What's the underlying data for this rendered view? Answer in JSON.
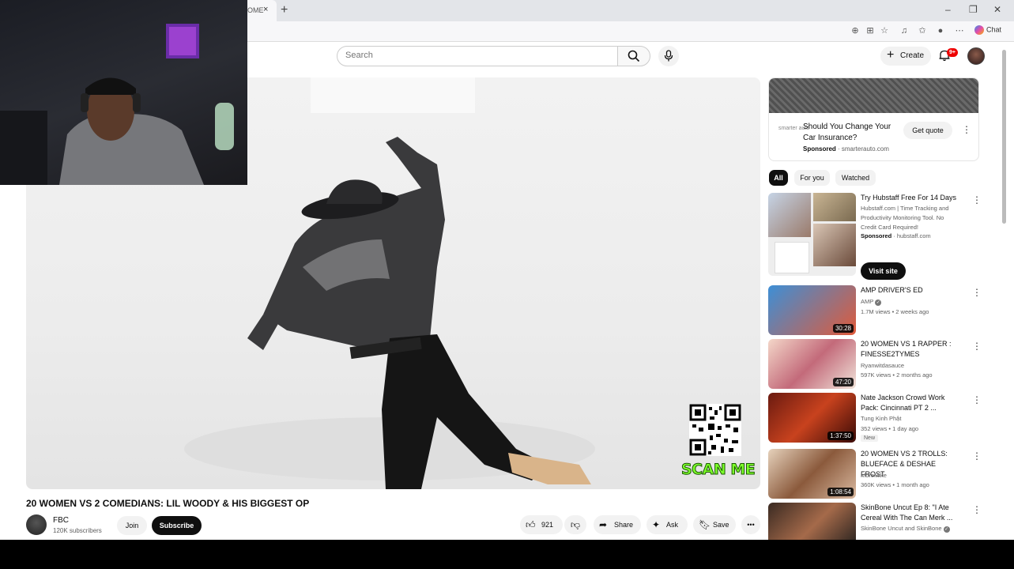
{
  "browser": {
    "tab_title": "OME",
    "tab_close": "×",
    "new_tab": "+",
    "window_buttons": [
      "–",
      "❐",
      "✕"
    ],
    "chat_label": "Chat"
  },
  "header": {
    "search_placeholder": "Search",
    "create_label": "Create",
    "notification_count": "9+"
  },
  "video": {
    "qr_caption": "SCAN ME",
    "title": "20 WOMEN VS 2 COMEDIANS: LIL WOODY & HIS BIGGEST OP",
    "channel_name": "FBC",
    "channel_subs": "120K subscribers",
    "join_label": "Join",
    "subscribe_label": "Subscribe",
    "like_count": "921",
    "share_label": "Share",
    "ask_label": "Ask",
    "save_label": "Save",
    "more_label": "•••"
  },
  "ad": {
    "logo_text": "smarter auto",
    "title": "Should You Change Your Car Insurance?",
    "sponsored": "Sponsored",
    "domain": "smarterauto.com",
    "cta": "Get quote"
  },
  "chips": [
    "All",
    "For you",
    "Watched"
  ],
  "recommendations": [
    {
      "title": "Try Hubstaff Free For 14 Days",
      "channel": "Hubstaff.com | Time Tracking and Productivity Monitoring Tool. No Credit Card Required!",
      "meta_sponsored": "Sponsored",
      "meta_domain": "hubstaff.com",
      "cta": "Visit site"
    },
    {
      "title": "AMP DRIVER'S ED",
      "channel": "AMP",
      "meta": "1.7M views • 2 weeks ago",
      "duration": "30:28"
    },
    {
      "title": "20 WOMEN VS 1 RAPPER : FINESSE2TYMES",
      "channel": "Ryanwitdasauce",
      "meta": "597K views • 2 months ago",
      "duration": "47:20"
    },
    {
      "title": "Nate Jackson Crowd Work Pack: Cincinnati PT 2 ...",
      "channel": "Tung Kinh Phật",
      "meta": "352 views • 1 day ago",
      "badge": "New",
      "duration": "1:37:50"
    },
    {
      "title": "20 WOMEN VS 2 TROLLS: BLUEFACE & DESHAE FROST",
      "channel": "MoreMike",
      "meta": "360K views • 1 month ago",
      "duration": "1:08:54"
    },
    {
      "title": "SkinBone Uncut Ep 8: \"I Ate Cereal With The Can Merk ...",
      "channel": "SkinBone Uncut and SkinBone"
    }
  ],
  "colors": {
    "accent_red": "#ee0000",
    "subscribe_bg": "#0f0f0f",
    "scan_me": "#7dff2a"
  }
}
